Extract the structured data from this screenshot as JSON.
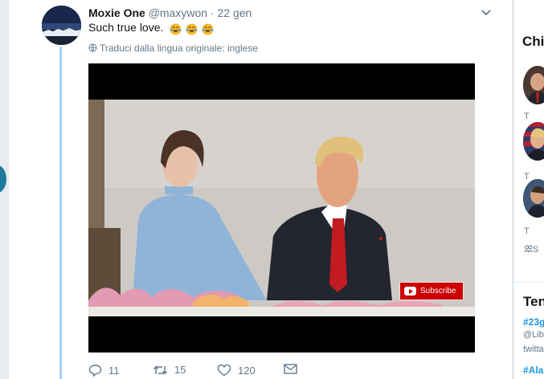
{
  "tweet": {
    "display_name": "Moxie One",
    "handle": "@maxywon",
    "separator": "·",
    "time": "22 gen",
    "text": "Such true love.",
    "emoji": [
      "face-with-tears-of-joy",
      "face-with-tears-of-joy",
      "face-with-tears-of-joy"
    ],
    "translate_label": "Traduci dalla lingua originale: inglese"
  },
  "video": {
    "subscribe_label": "Subscribe"
  },
  "actions": {
    "replies": "11",
    "retweets": "15",
    "likes": "120"
  },
  "right_panel": {
    "heading": "Chi",
    "text_t1": "T",
    "text_t2": "T",
    "text_t3": "T",
    "text_t4": "S",
    "trends_heading": "Ten",
    "trend_tag_1": "#23g",
    "trend_sub_1": "@Lib",
    "trend_sub_2": "twitta",
    "trend_tag_2": "#Ala"
  },
  "colors": {
    "link": "#1b95e0",
    "thread_line": "#9fd3ec",
    "muted": "#657786",
    "youtube_red": "#cc0000"
  }
}
